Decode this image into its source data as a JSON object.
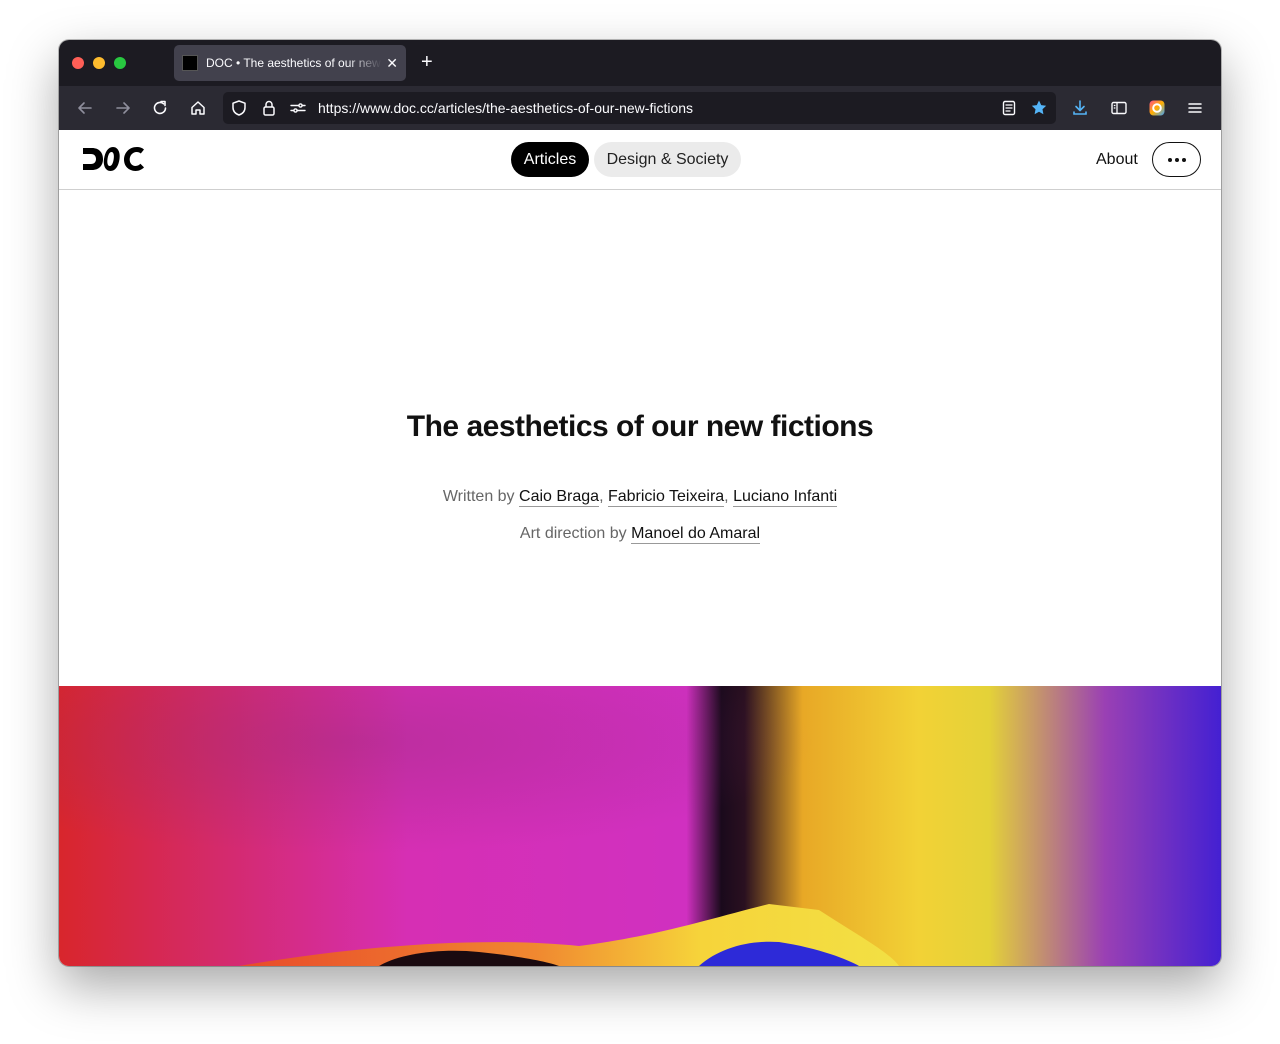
{
  "browser": {
    "tab": {
      "title": "DOC • The aesthetics of our new fictions",
      "close_glyph": "✕"
    },
    "new_tab_glyph": "+",
    "url": "https://www.doc.cc/articles/the-aesthetics-of-our-new-fictions",
    "bookmark_color": "#54b4f7"
  },
  "site": {
    "logo_text": "DOC",
    "nav": {
      "articles": "Articles",
      "design_society": "Design & Society"
    },
    "about": "About"
  },
  "article": {
    "title": "The aesthetics of our new fictions",
    "written_by_label": "Written by",
    "authors": [
      "Caio Braga",
      "Fabricio Teixeira",
      "Luciano Infanti"
    ],
    "art_direction_label": "Art direction by",
    "art_director": "Manoel do Amaral"
  }
}
